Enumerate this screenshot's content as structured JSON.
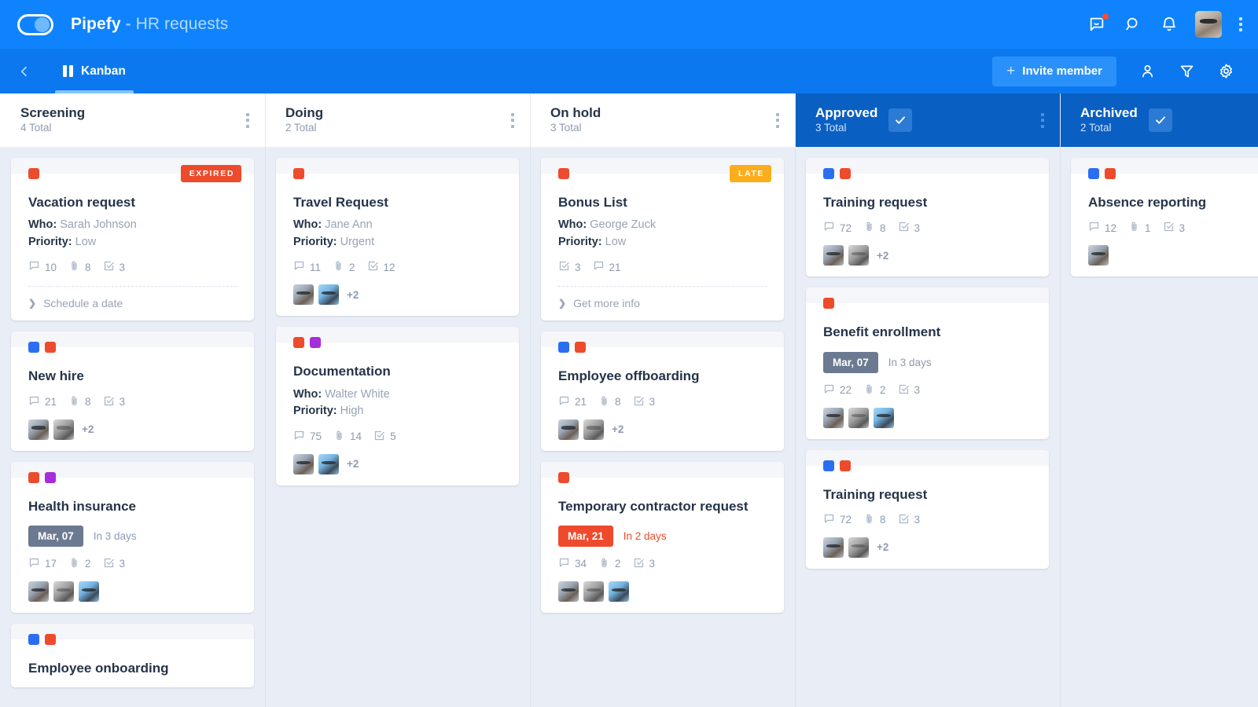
{
  "app": {
    "brand": "Pipefy",
    "separator": "-",
    "pipe_name": "HR requests"
  },
  "topbar": {
    "icons": [
      {
        "name": "feedback-icon",
        "label": "Feedback",
        "has_badge": true
      },
      {
        "name": "search-icon",
        "label": "Search",
        "has_badge": false
      },
      {
        "name": "notifications-icon",
        "label": "Notifications",
        "has_badge": false
      }
    ],
    "avatar_label": "User avatar",
    "menu_label": "More options"
  },
  "subnav": {
    "back_label": "Back",
    "tab_label": "Kanban",
    "invite_label": "Invite member",
    "invite_plus": "+",
    "right_icons": [
      {
        "name": "members-icon",
        "label": "Members"
      },
      {
        "name": "filter-icon",
        "label": "Filter"
      },
      {
        "name": "settings-icon",
        "label": "Settings"
      }
    ]
  },
  "colors": {
    "brand_blue": "#0f83fd",
    "subnav_blue": "#0b78ef",
    "done_header_blue": "#0a5fc2",
    "board_bg": "#e9edf5",
    "label_red": "#ed4b2c",
    "label_blue": "#2c6ef2",
    "label_purple": "#a72cdb",
    "flag_expired": "#ed4b2c",
    "flag_late": "#fbad1c",
    "date_grey": "#6b7a91",
    "date_red": "#ed4b2c"
  },
  "columns": [
    {
      "title": "Screening",
      "total": "4 Total",
      "done": false,
      "cards": [
        {
          "title": "Vacation request",
          "labels": [
            "red"
          ],
          "flag": {
            "text": "EXPIRED",
            "kind": "expired"
          },
          "fields": [
            {
              "key": "Who:",
              "value": "Sarah Johnson"
            },
            {
              "key": "Priority:",
              "value": "Low"
            }
          ],
          "meta": [
            {
              "icon": "comment-icon",
              "count": "10"
            },
            {
              "icon": "attachment-icon",
              "count": "8"
            },
            {
              "icon": "checklist-icon",
              "count": "3"
            }
          ],
          "avatars": [],
          "avatars_more": "",
          "link": "Schedule a date"
        },
        {
          "title": "New hire",
          "labels": [
            "blue",
            "red"
          ],
          "meta": [
            {
              "icon": "comment-icon",
              "count": "21"
            },
            {
              "icon": "attachment-icon",
              "count": "8"
            },
            {
              "icon": "checklist-icon",
              "count": "3"
            }
          ],
          "avatars": [
            "a",
            "b"
          ],
          "avatars_more": "+2"
        },
        {
          "title": "Health insurance",
          "labels": [
            "red",
            "purple"
          ],
          "date": {
            "pill": "Mar, 07",
            "pill_kind": "grey",
            "when": "In 3 days",
            "when_kind": "grey"
          },
          "meta": [
            {
              "icon": "comment-icon",
              "count": "17"
            },
            {
              "icon": "attachment-icon",
              "count": "2"
            },
            {
              "icon": "checklist-icon",
              "count": "3"
            }
          ],
          "avatars": [
            "a",
            "b",
            "c"
          ],
          "avatars_more": ""
        },
        {
          "title": "Employee onboarding",
          "labels": [
            "blue",
            "red"
          ],
          "meta": [],
          "avatars": [],
          "avatars_more": ""
        }
      ]
    },
    {
      "title": "Doing",
      "total": "2 Total",
      "done": false,
      "cards": [
        {
          "title": "Travel Request",
          "labels": [
            "red"
          ],
          "fields": [
            {
              "key": "Who:",
              "value": "Jane Ann"
            },
            {
              "key": "Priority:",
              "value": "Urgent"
            }
          ],
          "meta": [
            {
              "icon": "comment-icon",
              "count": "11"
            },
            {
              "icon": "attachment-icon",
              "count": "2"
            },
            {
              "icon": "checklist-icon",
              "count": "12"
            }
          ],
          "avatars": [
            "a",
            "c"
          ],
          "avatars_more": "+2"
        },
        {
          "title": "Documentation",
          "labels": [
            "red",
            "purple"
          ],
          "fields": [
            {
              "key": "Who:",
              "value": "Walter White"
            },
            {
              "key": "Priority:",
              "value": "High"
            }
          ],
          "meta": [
            {
              "icon": "comment-icon",
              "count": "75"
            },
            {
              "icon": "attachment-icon",
              "count": "14"
            },
            {
              "icon": "checklist-icon",
              "count": "5"
            }
          ],
          "avatars": [
            "a",
            "c"
          ],
          "avatars_more": "+2"
        }
      ]
    },
    {
      "title": "On hold",
      "total": "3 Total",
      "done": false,
      "cards": [
        {
          "title": "Bonus List",
          "labels": [
            "red"
          ],
          "flag": {
            "text": "LATE",
            "kind": "late"
          },
          "fields": [
            {
              "key": "Who:",
              "value": "George Zuck"
            },
            {
              "key": "Priority:",
              "value": "Low"
            }
          ],
          "meta": [
            {
              "icon": "checklist-icon",
              "count": "3"
            },
            {
              "icon": "comment-icon",
              "count": "21"
            }
          ],
          "avatars": [],
          "avatars_more": "",
          "link": "Get more info"
        },
        {
          "title": "Employee offboarding",
          "labels": [
            "blue",
            "red"
          ],
          "meta": [
            {
              "icon": "comment-icon",
              "count": "21"
            },
            {
              "icon": "attachment-icon",
              "count": "8"
            },
            {
              "icon": "checklist-icon",
              "count": "3"
            }
          ],
          "avatars": [
            "a",
            "b"
          ],
          "avatars_more": "+2"
        },
        {
          "title": "Temporary contractor request",
          "labels": [
            "red"
          ],
          "date": {
            "pill": "Mar, 21",
            "pill_kind": "red",
            "when": "In 2 days",
            "when_kind": "red"
          },
          "meta": [
            {
              "icon": "comment-icon",
              "count": "34"
            },
            {
              "icon": "attachment-icon",
              "count": "2"
            },
            {
              "icon": "checklist-icon",
              "count": "3"
            }
          ],
          "avatars": [
            "a",
            "b",
            "c"
          ],
          "avatars_more": ""
        }
      ]
    },
    {
      "title": "Approved",
      "total": "3 Total",
      "done": true,
      "cards": [
        {
          "title": "Training request",
          "labels": [
            "blue",
            "red"
          ],
          "meta": [
            {
              "icon": "comment-icon",
              "count": "72"
            },
            {
              "icon": "attachment-icon",
              "count": "8"
            },
            {
              "icon": "checklist-icon",
              "count": "3"
            }
          ],
          "avatars": [
            "a",
            "b"
          ],
          "avatars_more": "+2"
        },
        {
          "title": "Benefit enrollment",
          "labels": [
            "red"
          ],
          "date": {
            "pill": "Mar, 07",
            "pill_kind": "grey",
            "when": "In 3 days",
            "when_kind": "grey"
          },
          "meta": [
            {
              "icon": "comment-icon",
              "count": "22"
            },
            {
              "icon": "attachment-icon",
              "count": "2"
            },
            {
              "icon": "checklist-icon",
              "count": "3"
            }
          ],
          "avatars": [
            "a",
            "b",
            "c"
          ],
          "avatars_more": ""
        },
        {
          "title": "Training request",
          "labels": [
            "blue",
            "red"
          ],
          "meta": [
            {
              "icon": "comment-icon",
              "count": "72"
            },
            {
              "icon": "attachment-icon",
              "count": "8"
            },
            {
              "icon": "checklist-icon",
              "count": "3"
            }
          ],
          "avatars": [
            "a",
            "b"
          ],
          "avatars_more": "+2"
        }
      ]
    },
    {
      "title": "Archived",
      "total": "2 Total",
      "done": true,
      "cards": [
        {
          "title": "Absence reporting",
          "labels": [
            "blue",
            "red"
          ],
          "meta": [
            {
              "icon": "comment-icon",
              "count": "12"
            },
            {
              "icon": "attachment-icon",
              "count": "1"
            },
            {
              "icon": "checklist-icon",
              "count": "3"
            }
          ],
          "avatars": [
            "a"
          ],
          "avatars_more": ""
        }
      ]
    }
  ]
}
